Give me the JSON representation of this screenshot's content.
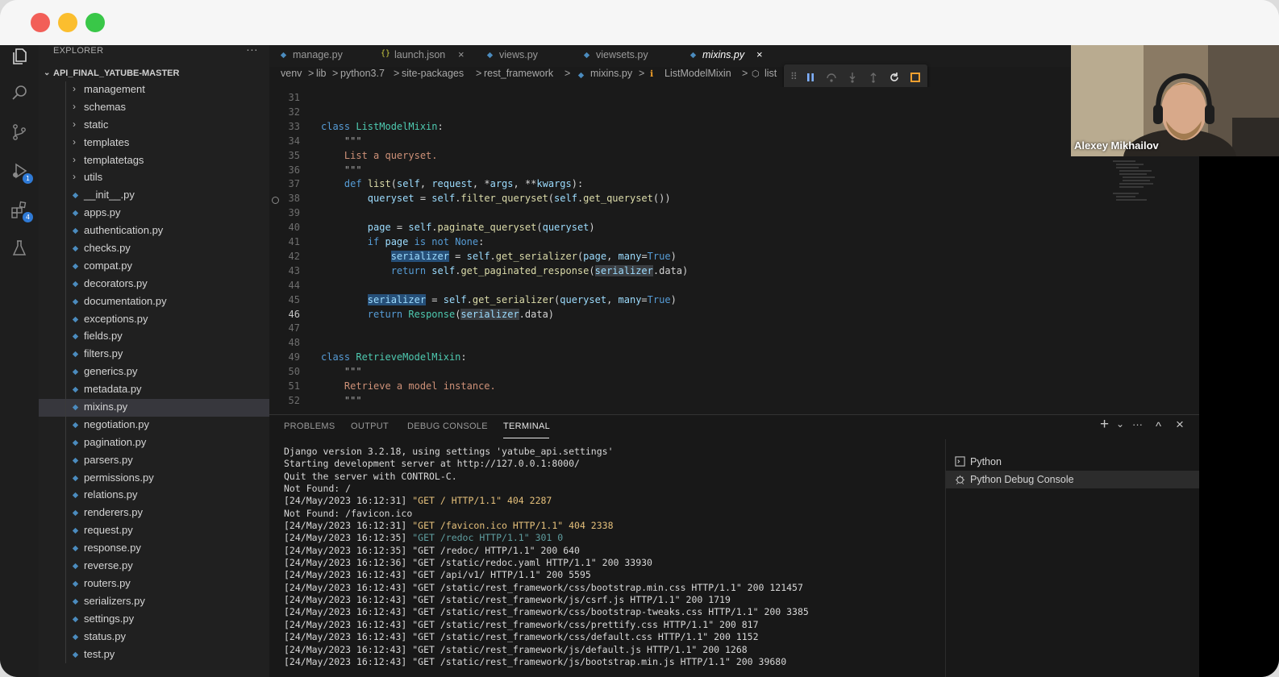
{
  "window": {
    "controls": [
      "close",
      "minimize",
      "maximize"
    ]
  },
  "activity_bar": {
    "items": [
      {
        "name": "explorer-icon"
      },
      {
        "name": "search-icon"
      },
      {
        "name": "source-control-icon"
      },
      {
        "name": "run-debug-icon",
        "badge": "1"
      },
      {
        "name": "extensions-icon",
        "badge": "4"
      },
      {
        "name": "testing-icon"
      }
    ]
  },
  "explorer": {
    "title": "EXPLORER",
    "more": "···",
    "folder": "API_FINAL_YATUBE-MASTER",
    "items": [
      {
        "name": "management",
        "type": "folder"
      },
      {
        "name": "schemas",
        "type": "folder"
      },
      {
        "name": "static",
        "type": "folder"
      },
      {
        "name": "templates",
        "type": "folder"
      },
      {
        "name": "templatetags",
        "type": "folder"
      },
      {
        "name": "utils",
        "type": "folder"
      },
      {
        "name": "__init__.py",
        "type": "file"
      },
      {
        "name": "apps.py",
        "type": "file"
      },
      {
        "name": "authentication.py",
        "type": "file"
      },
      {
        "name": "checks.py",
        "type": "file"
      },
      {
        "name": "compat.py",
        "type": "file"
      },
      {
        "name": "decorators.py",
        "type": "file"
      },
      {
        "name": "documentation.py",
        "type": "file"
      },
      {
        "name": "exceptions.py",
        "type": "file"
      },
      {
        "name": "fields.py",
        "type": "file"
      },
      {
        "name": "filters.py",
        "type": "file"
      },
      {
        "name": "generics.py",
        "type": "file"
      },
      {
        "name": "metadata.py",
        "type": "file"
      },
      {
        "name": "mixins.py",
        "type": "file",
        "selected": true
      },
      {
        "name": "negotiation.py",
        "type": "file"
      },
      {
        "name": "pagination.py",
        "type": "file"
      },
      {
        "name": "parsers.py",
        "type": "file"
      },
      {
        "name": "permissions.py",
        "type": "file"
      },
      {
        "name": "relations.py",
        "type": "file"
      },
      {
        "name": "renderers.py",
        "type": "file"
      },
      {
        "name": "request.py",
        "type": "file"
      },
      {
        "name": "response.py",
        "type": "file"
      },
      {
        "name": "reverse.py",
        "type": "file"
      },
      {
        "name": "routers.py",
        "type": "file"
      },
      {
        "name": "serializers.py",
        "type": "file"
      },
      {
        "name": "settings.py",
        "type": "file"
      },
      {
        "name": "status.py",
        "type": "file"
      },
      {
        "name": "test.py",
        "type": "file"
      }
    ]
  },
  "tabs": [
    {
      "label": "manage.py",
      "icon": "python-file-icon"
    },
    {
      "label": "launch.json",
      "icon": "json-file-icon",
      "close": "×"
    },
    {
      "label": "views.py",
      "icon": "python-file-icon"
    },
    {
      "label": "viewsets.py",
      "icon": "python-file-icon"
    },
    {
      "label": "mixins.py",
      "icon": "python-file-icon",
      "active": true,
      "close": "×"
    }
  ],
  "breadcrumb": [
    "venv",
    "lib",
    "python3.7",
    "site-packages",
    "rest_framework",
    "mixins.py",
    "ListModelMixin",
    "list"
  ],
  "breadcrumb_separator": ">",
  "code": {
    "lines": [
      {
        "n": "31",
        "t": ""
      },
      {
        "n": "32",
        "t": ""
      },
      {
        "n": "33",
        "t": "class ListModelMixin:"
      },
      {
        "n": "34",
        "t": "    \"\"\""
      },
      {
        "n": "35",
        "t": "    List a queryset."
      },
      {
        "n": "36",
        "t": "    \"\"\""
      },
      {
        "n": "37",
        "t": "    def list(self, request, *args, **kwargs):"
      },
      {
        "n": "38",
        "t": "        queryset = self.filter_queryset(self.get_queryset())"
      },
      {
        "n": "39",
        "t": ""
      },
      {
        "n": "40",
        "t": "        page = self.paginate_queryset(queryset)"
      },
      {
        "n": "41",
        "t": "        if page is not None:"
      },
      {
        "n": "42",
        "t": "            serializer = self.get_serializer(page, many=True)"
      },
      {
        "n": "43",
        "t": "            return self.get_paginated_response(serializer.data)"
      },
      {
        "n": "44",
        "t": ""
      },
      {
        "n": "45",
        "t": "        serializer = self.get_serializer(queryset, many=True)"
      },
      {
        "n": "46",
        "t": "        return Response(serializer.data)"
      },
      {
        "n": "47",
        "t": ""
      },
      {
        "n": "48",
        "t": ""
      },
      {
        "n": "49",
        "t": "class RetrieveModelMixin:"
      },
      {
        "n": "50",
        "t": "    \"\"\""
      },
      {
        "n": "51",
        "t": "    Retrieve a model instance."
      },
      {
        "n": "52",
        "t": "    \"\"\""
      }
    ]
  },
  "panel": {
    "tabs": [
      "PROBLEMS",
      "OUTPUT",
      "DEBUG CONSOLE",
      "TERMINAL"
    ],
    "active_tab": "TERMINAL",
    "controls": {
      "add": "+",
      "split": "⌄",
      "more": "···",
      "maximize": "^",
      "close": "×"
    },
    "terminal_lines": [
      "Django version 3.2.18, using settings 'yatube_api.settings'",
      "Starting development server at http://127.0.0.1:8000/",
      "Quit the server with CONTROL-C.",
      "Not Found: /",
      "[24/May/2023 16:12:31] \"GET / HTTP/1.1\" 404 2287",
      "Not Found: /favicon.ico",
      "[24/May/2023 16:12:31] \"GET /favicon.ico HTTP/1.1\" 404 2338",
      "[24/May/2023 16:12:35] \"GET /redoc HTTP/1.1\" 301 0",
      "[24/May/2023 16:12:35] \"GET /redoc/ HTTP/1.1\" 200 640",
      "[24/May/2023 16:12:36] \"GET /static/redoc.yaml HTTP/1.1\" 200 33930",
      "[24/May/2023 16:12:43] \"GET /api/v1/ HTTP/1.1\" 200 5595",
      "[24/May/2023 16:12:43] \"GET /static/rest_framework/css/bootstrap.min.css HTTP/1.1\" 200 121457",
      "[24/May/2023 16:12:43] \"GET /static/rest_framework/js/csrf.js HTTP/1.1\" 200 1719",
      "[24/May/2023 16:12:43] \"GET /static/rest_framework/css/bootstrap-tweaks.css HTTP/1.1\" 200 3385",
      "[24/May/2023 16:12:43] \"GET /static/rest_framework/css/prettify.css HTTP/1.1\" 200 817",
      "[24/May/2023 16:12:43] \"GET /static/rest_framework/css/default.css HTTP/1.1\" 200 1152",
      "[24/May/2023 16:12:43] \"GET /static/rest_framework/js/default.js HTTP/1.1\" 200 1268",
      "[24/May/2023 16:12:43] \"GET /static/rest_framework/js/bootstrap.min.js HTTP/1.1\" 200 39680"
    ],
    "terminals": [
      {
        "label": "Python",
        "icon": "terminal-icon"
      },
      {
        "label": "Python Debug Console",
        "icon": "debug-icon",
        "selected": true
      }
    ]
  },
  "webcam": {
    "name": "Alexey Mikhailov"
  },
  "colors": {
    "accent": "#2f7ad6",
    "python_icon": "#4b8bbe",
    "json_icon": "#cbcb41",
    "string_log": "#e5c07b",
    "redirect_log": "#5f9ea0"
  }
}
